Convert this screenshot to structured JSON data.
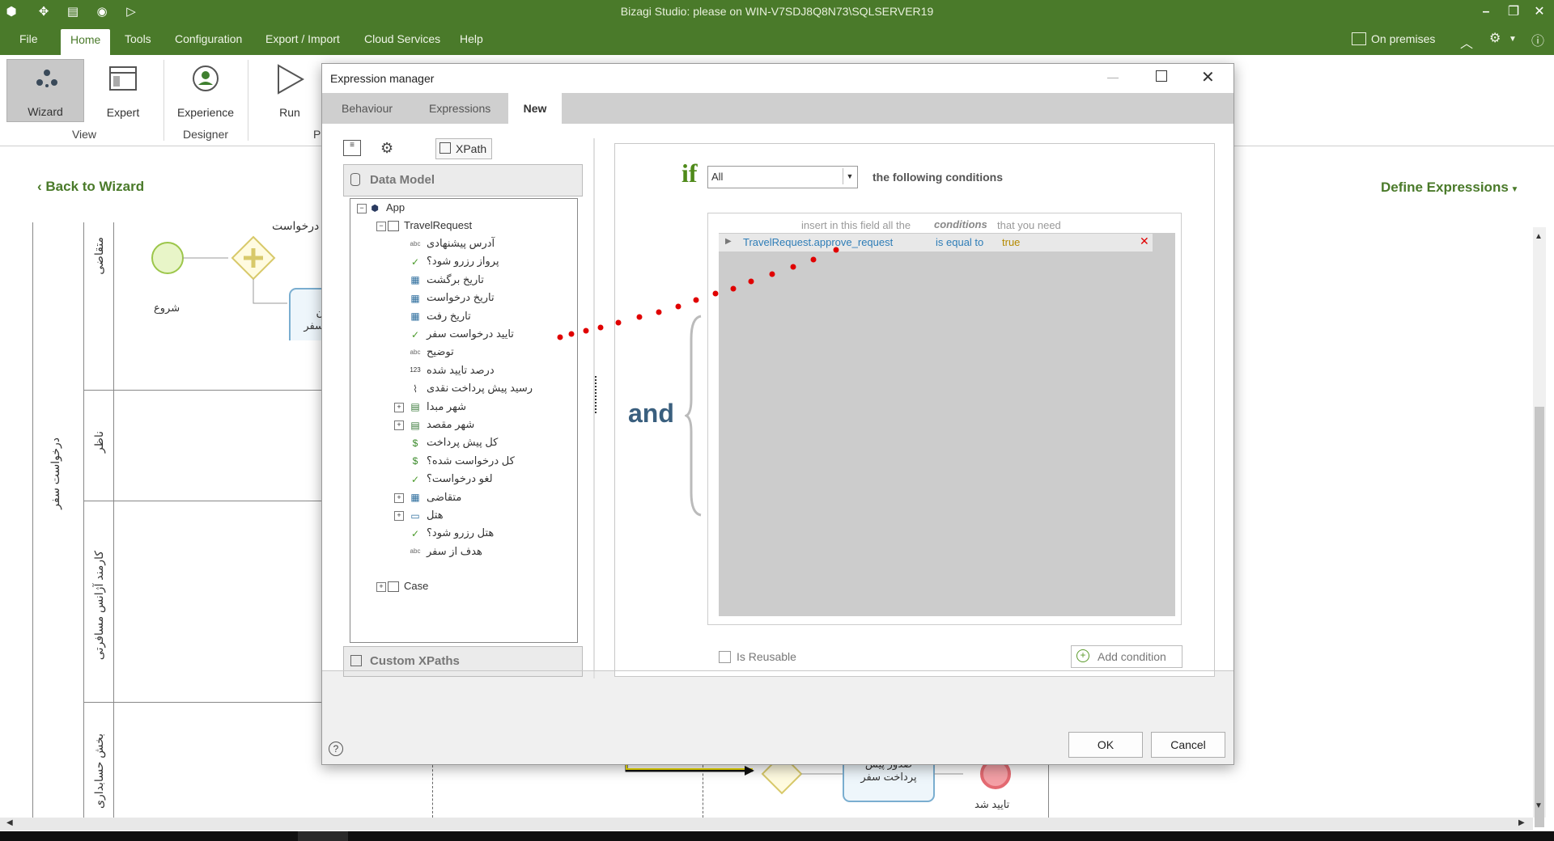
{
  "app": {
    "title": "Bizagi Studio: please  on WIN-V7SDJ8Q8N73\\SQLSERVER19",
    "menu": [
      "File",
      "Home",
      "Tools",
      "Configuration",
      "Export / Import",
      "Cloud Services",
      "Help"
    ],
    "on_premises": "On premises"
  },
  "ribbon": {
    "buttons": {
      "wizard": "Wizard",
      "expert": "Expert",
      "experience": "Experience",
      "run": "Run"
    },
    "groups": {
      "view": "View",
      "designer": "Designer",
      "pr": "Pr"
    }
  },
  "canvas": {
    "back": "Back to Wizard",
    "define": "Define Expressions",
    "pool_label": "درخواست سفر",
    "lanes": [
      "متقاضی",
      "ناظر",
      "کارمند آژانس مسافرتی",
      "بخش حسابداری"
    ],
    "start_label": "شروع",
    "top_text": "درخواست",
    "task1": "ن\nسفر",
    "task2": "صدور پیش\nپرداخت سفر",
    "end_label": "تایید شد"
  },
  "dialog": {
    "title": "Expression manager",
    "tabs": [
      "Behaviour",
      "Expressions",
      "New"
    ],
    "xpath_label": "XPath",
    "data_model_title": "Data Model",
    "custom_xpaths": "Custom XPaths",
    "tree": {
      "app": "App",
      "travel_request": "TravelRequest",
      "fields": [
        {
          "label": "آدرس پیشنهادی",
          "icon": "abc"
        },
        {
          "label": "پرواز رزرو شود؟",
          "icon": "check"
        },
        {
          "label": "تاریخ برگشت",
          "icon": "calendar"
        },
        {
          "label": "تاریخ درخواست",
          "icon": "calendar"
        },
        {
          "label": "تاریخ رفت",
          "icon": "calendar"
        },
        {
          "label": "تایید درخواست سفر",
          "icon": "check"
        },
        {
          "label": "توضیح",
          "icon": "abc"
        },
        {
          "label": "درصد تایید شده",
          "icon": "123"
        },
        {
          "label": "رسید پیش پرداخت نقدی",
          "icon": "paperclip"
        },
        {
          "label": "شهر مبدا",
          "icon": "table"
        },
        {
          "label": "شهر مقصد",
          "icon": "table"
        },
        {
          "label": "کل پیش پرداخت",
          "icon": "dollar"
        },
        {
          "label": "کل درخواست شده؟",
          "icon": "dollar"
        },
        {
          "label": "لغو درخواست؟",
          "icon": "check"
        },
        {
          "label": "متقاضی",
          "icon": "grid"
        },
        {
          "label": "هتل",
          "icon": "entity"
        },
        {
          "label": "هتل رزرو شود؟",
          "icon": "check"
        },
        {
          "label": "هدف از سفر",
          "icon": "abc"
        }
      ],
      "case": "Case"
    },
    "if_label": "if",
    "condition_select": "All",
    "following": "the following conditions",
    "hint": [
      "insert in this field all the",
      "conditions",
      "that you need"
    ],
    "condition": {
      "field": "TravelRequest.approve_request",
      "operator": "is equal to",
      "value": "true"
    },
    "and_label": "and",
    "is_reusable": "Is Reusable",
    "add_condition": "Add condition",
    "ok": "OK",
    "cancel": "Cancel"
  },
  "colors": {
    "brand": "#4a7a2a",
    "accent_link": "#2e7db7",
    "if_green": "#4f8a1a",
    "dots": "#e00000"
  }
}
